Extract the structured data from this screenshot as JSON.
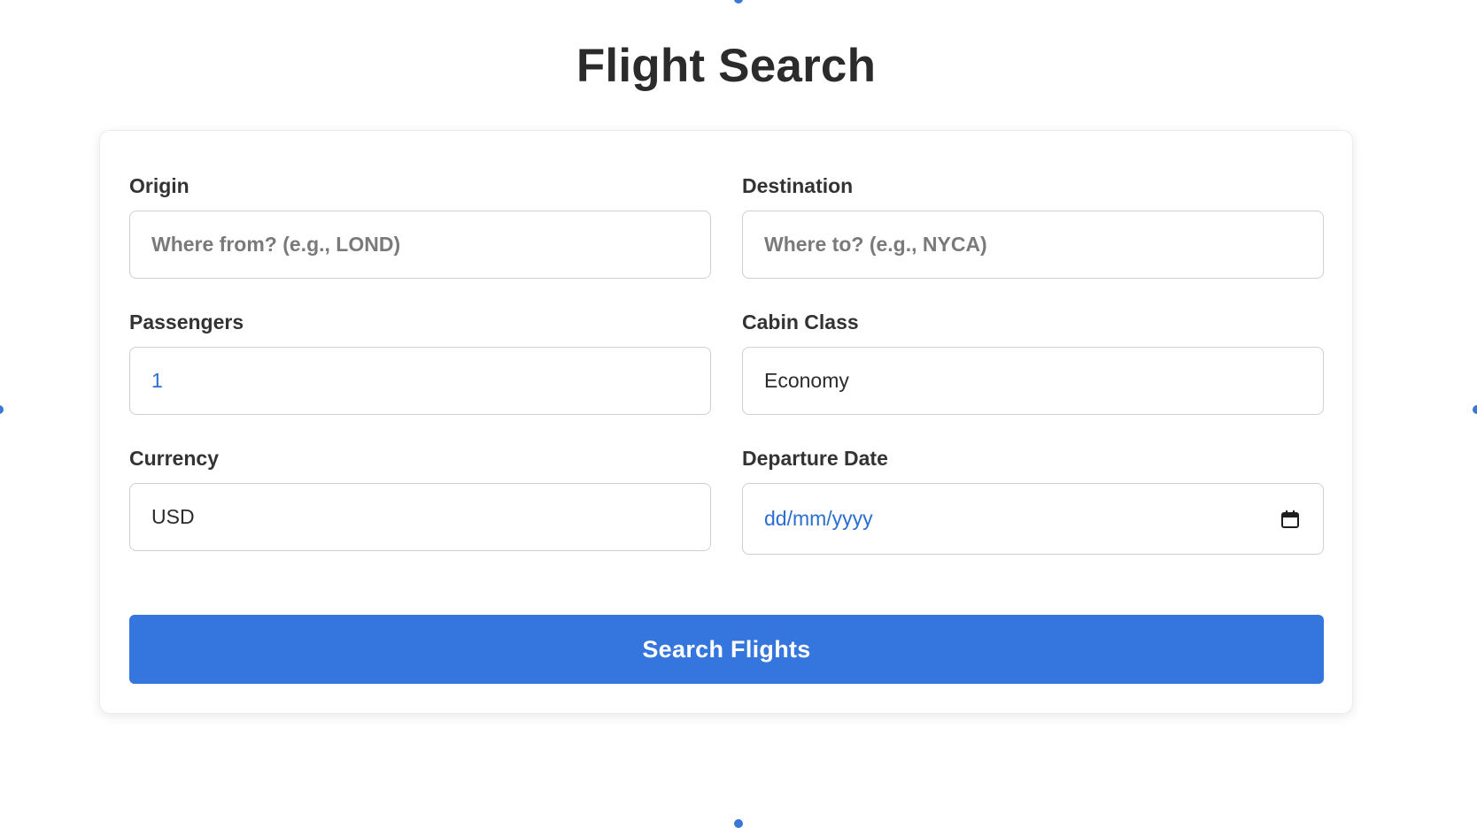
{
  "page": {
    "title": "Flight Search"
  },
  "form": {
    "origin": {
      "label": "Origin",
      "value": "",
      "placeholder": "Where from? (e.g., LOND)"
    },
    "destination": {
      "label": "Destination",
      "value": "",
      "placeholder": "Where to? (e.g., NYCA)"
    },
    "passengers": {
      "label": "Passengers",
      "value": "1"
    },
    "cabin_class": {
      "label": "Cabin Class",
      "value": "Economy"
    },
    "currency": {
      "label": "Currency",
      "value": "USD"
    },
    "departure_date": {
      "label": "Departure Date",
      "value": "dd/mm/yyyy",
      "icon": "calendar-icon"
    },
    "submit_label": "Search Flights"
  },
  "colors": {
    "accent": "#3576de",
    "value_blue": "#2a6ecf",
    "title_text": "#2b2b2b",
    "border": "#cfcfcf"
  }
}
